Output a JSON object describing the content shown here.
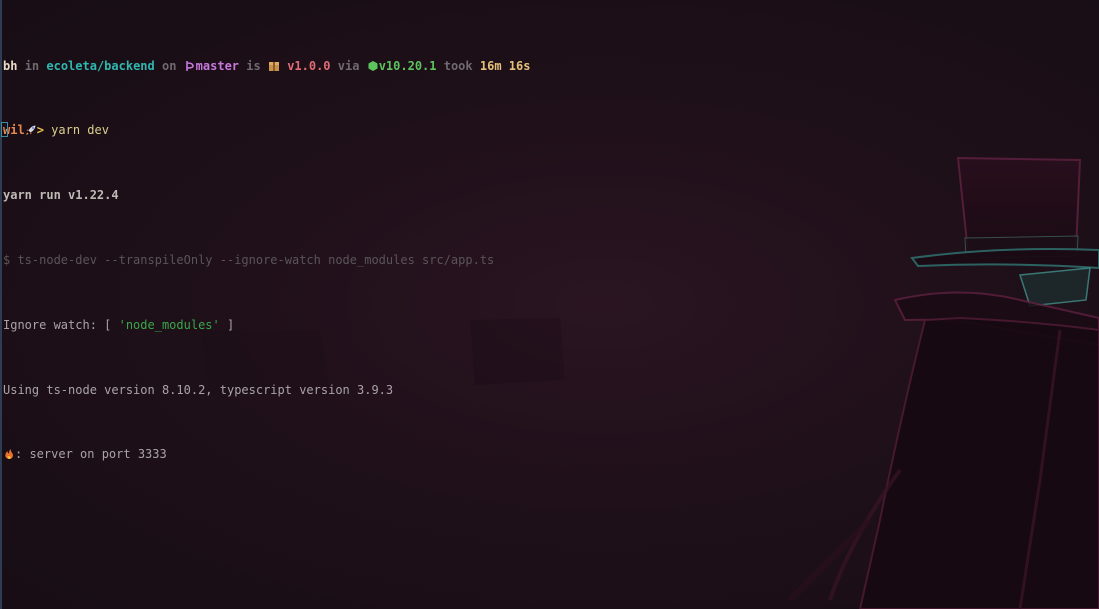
{
  "window": {
    "title": ""
  },
  "prompt": {
    "user": "bh",
    "in_word": "in",
    "directory": "ecoleta/backend",
    "on_word": "on",
    "branch_icon": "git-branch-icon",
    "branch": "master",
    "is_word": "is",
    "package_icon": "package-icon",
    "version": "v1.0.0",
    "via_word": "via",
    "node_icon": "node-hexagon-icon",
    "node_version": "v10.20.1",
    "took_word": "took",
    "duration": "16m 16s"
  },
  "command_line": {
    "host": "wil",
    "rocket_icon": "rocket-icon",
    "arrow": ">",
    "command": "yarn dev"
  },
  "output": {
    "yarn_run": "yarn run v1.22.4",
    "echo_cmd": "$ ts-node-dev --transpileOnly --ignore-watch node_modules src/app.ts",
    "ignore_watch_prefix": "Ignore watch: [ ",
    "ignore_watch_value": "'node_modules'",
    "ignore_watch_suffix": " ]",
    "ts_node_version": "Using ts-node version 8.10.2, typescript version 3.9.3",
    "fire_icon": "fire-icon",
    "server_text": ": server on port 3333"
  },
  "colors": {
    "background": "#1f1019",
    "directory": "#2fb7b0",
    "branch": "#c678dd",
    "version": "#e06c75",
    "node": "#5dc45d",
    "duration": "#e5c07b",
    "string": "#3aa64a"
  }
}
